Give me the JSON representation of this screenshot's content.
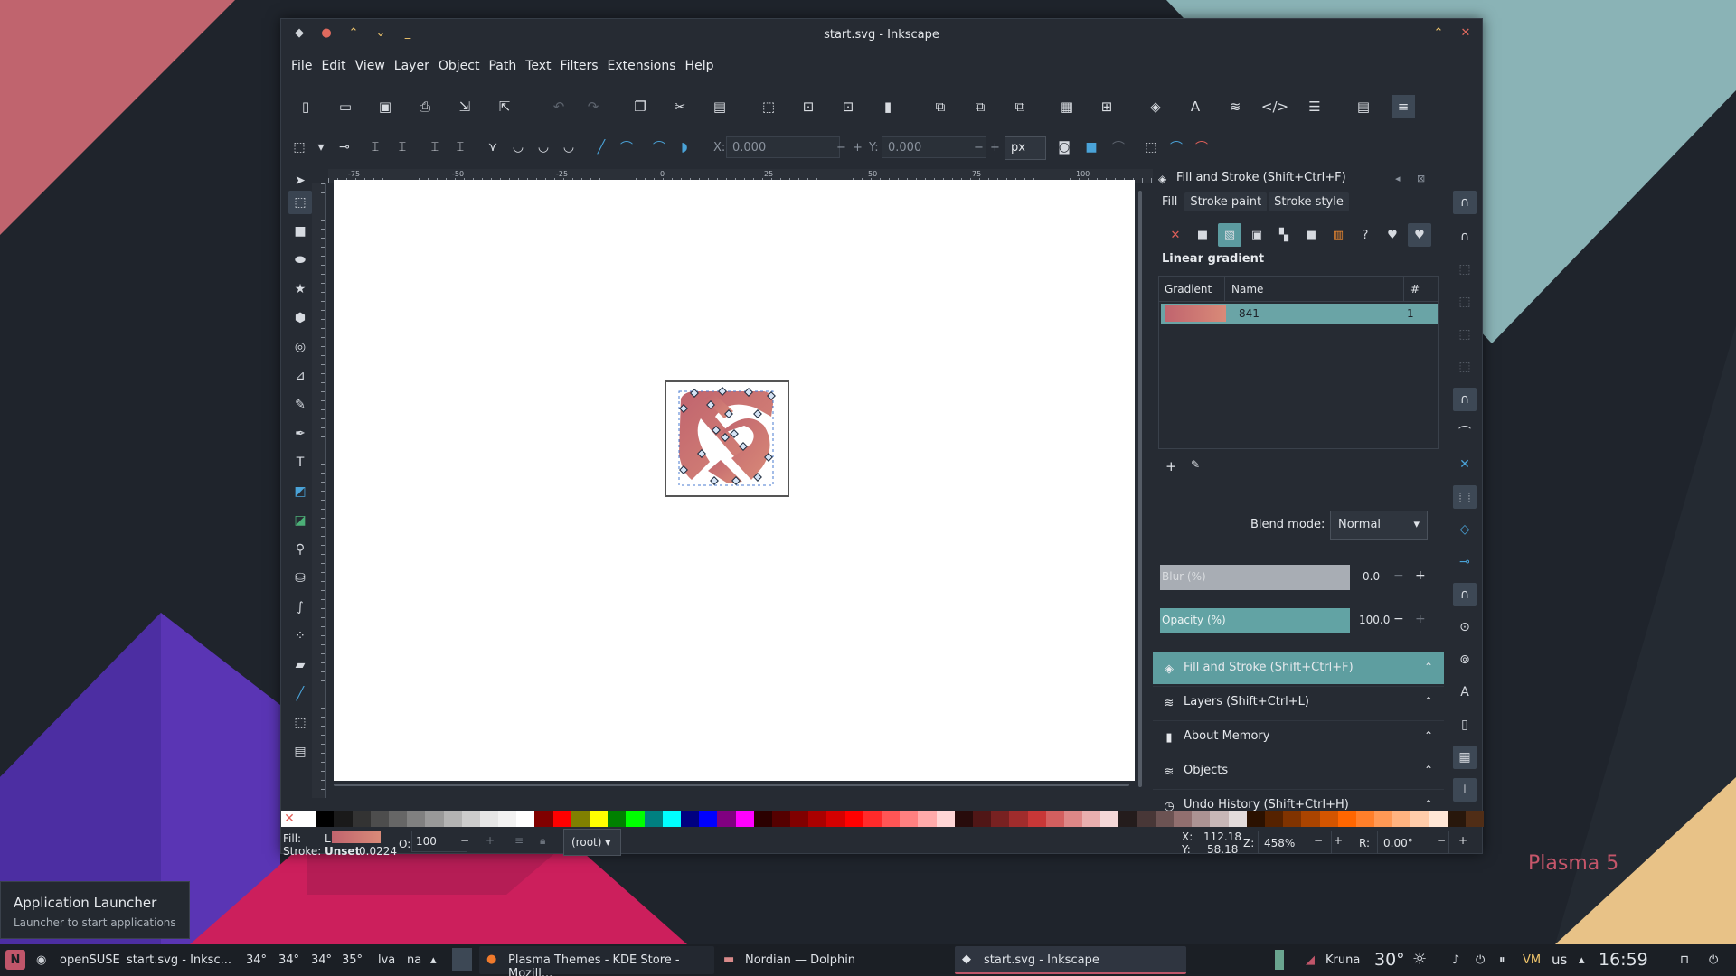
{
  "window": {
    "title": "start.svg - Inkscape"
  },
  "menu": [
    "File",
    "Edit",
    "View",
    "Layer",
    "Object",
    "Path",
    "Text",
    "Filters",
    "Extensions",
    "Help"
  ],
  "toolctl": {
    "x_label": "X:",
    "x_value": "0.000",
    "y_label": "Y:",
    "y_value": "0.000",
    "unit": "px"
  },
  "ruler_ticks": [
    "-75",
    "-50",
    "-25",
    "0",
    "25",
    "50",
    "75",
    "100"
  ],
  "panel": {
    "title": "Fill and Stroke (Shift+Ctrl+F)",
    "tabs": [
      "Fill",
      "Stroke paint",
      "Stroke style"
    ],
    "paint_type": "Linear gradient",
    "table_headers": {
      "gradient": "Gradient",
      "name": "Name",
      "count": "#"
    },
    "gradient_row": {
      "name": "841",
      "count": "1"
    },
    "blend_label": "Blend mode:",
    "blend_value": "Normal",
    "blur_label": "Blur (%)",
    "blur_value": "0.0",
    "opacity_label": "Opacity (%)",
    "opacity_value": "100.0"
  },
  "docks": [
    "Fill and Stroke (Shift+Ctrl+F)",
    "Layers (Shift+Ctrl+L)",
    "About Memory",
    "Objects",
    "Undo History (Shift+Ctrl+H)"
  ],
  "status": {
    "fill_label": "Fill:",
    "fill_value": "L",
    "stroke_label": "Stroke:",
    "stroke_value": "Unset",
    "stroke_width": "0.0224",
    "o_label": "O:",
    "opacity": "100",
    "layer": "(root)",
    "x_label": "X:",
    "x": "112.18",
    "y_label": "Y:",
    "y": "58.18",
    "z_label": "Z:",
    "zoom": "458%",
    "r_label": "R:",
    "rotation": "0.00°"
  },
  "launcher": {
    "title": "Application Launcher",
    "subtitle": "Launcher to start applications"
  },
  "taskbar": {
    "os": "openSUSE",
    "active_short": "start.svg - Inksc...",
    "temps": [
      "34°",
      "34°",
      "34°",
      "35°"
    ],
    "misc": [
      "lva",
      "na"
    ],
    "tasks": [
      "Plasma Themes - KDE Store - Mozill...",
      "Nordian — Dolphin",
      "start.svg - Inkscape"
    ],
    "city": "Kruna",
    "weather": "30°",
    "kbd": "us",
    "clock": "16:59"
  },
  "plasma_label": "Plasma 5",
  "colors": {
    "accent": "#62a3a4",
    "gradient_start": "#c0646e",
    "gradient_end": "#d98a78",
    "window_bg": "#262b33"
  },
  "palette": [
    "#ffffff",
    "#000000",
    "#1a1a1a",
    "#333333",
    "#4d4d4d",
    "#666666",
    "#808080",
    "#999999",
    "#b3b3b3",
    "#cccccc",
    "#e6e6e6",
    "#f2f2f2",
    "#ffffff",
    "#800000",
    "#ff0000",
    "#808000",
    "#ffff00",
    "#008000",
    "#00ff00",
    "#008080",
    "#00ffff",
    "#000080",
    "#0000ff",
    "#800080",
    "#ff00ff",
    "#2b0000",
    "#550000",
    "#800000",
    "#aa0000",
    "#d40000",
    "#ff0000",
    "#ff2a2a",
    "#ff5555",
    "#ff8080",
    "#ffaaaa",
    "#ffd5d5",
    "#280b0b",
    "#501616",
    "#782121",
    "#a02c2c",
    "#c83737",
    "#d35f5f",
    "#de8787",
    "#e9afaf",
    "#f4d7d7",
    "#241c1c",
    "#483737",
    "#6c5353",
    "#916f6f",
    "#ac9393",
    "#c8b7b7",
    "#e3dbdb",
    "#2b1100",
    "#552200",
    "#803300",
    "#aa4400",
    "#d45500",
    "#ff6600",
    "#ff7f2a",
    "#ff9955",
    "#ffb380",
    "#ffccaa",
    "#ffe6d5",
    "#28170b",
    "#502d16"
  ]
}
